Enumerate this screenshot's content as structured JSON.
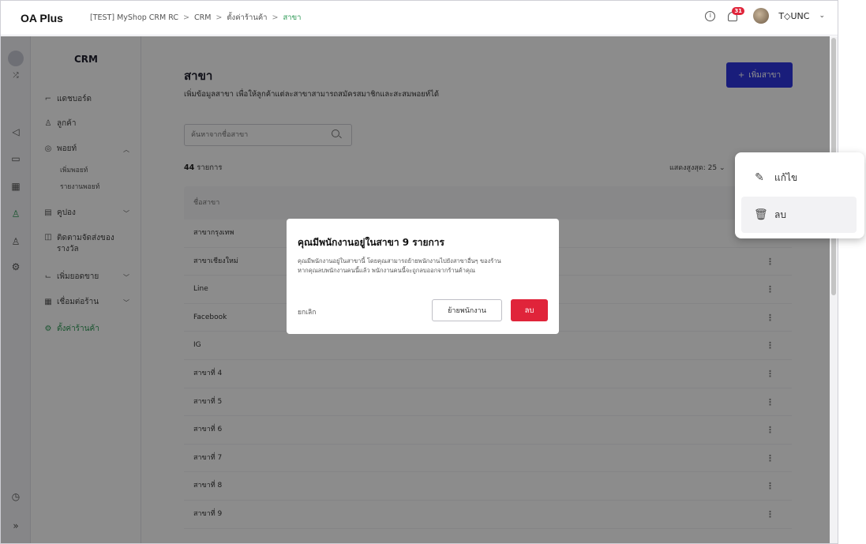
{
  "topbar": {
    "logo": "OA Plus",
    "breadcrumb": [
      "[TEST] MyShop CRM RC",
      "CRM",
      "ตั้งค่าร้านค้า",
      "สาขา"
    ],
    "notification_count": "31",
    "user_name": "T◇UNC"
  },
  "sidebar": {
    "title": "CRM",
    "items": [
      {
        "label": "แดชบอร์ด",
        "icon": "chart-icon"
      },
      {
        "label": "ลูกค้า",
        "icon": "users-icon"
      },
      {
        "label": "พอยท์",
        "icon": "point-icon"
      },
      {
        "label": "เพิ่มพอยท์"
      },
      {
        "label": "รายงานพอยท์"
      },
      {
        "label": "คูปอง",
        "icon": "coupon-icon"
      },
      {
        "label": "ติดตามจัดส่งของรางวัล",
        "icon": "gift-icon"
      },
      {
        "label": "เพิ่มยอดขาย",
        "icon": "sales-icon"
      },
      {
        "label": "เชื่อมต่อร้าน",
        "icon": "store-icon"
      },
      {
        "label": "ตั้งค่าร้านค้า",
        "icon": "settings-icon"
      }
    ]
  },
  "main": {
    "title": "สาขา",
    "description": "เพิ่มข้อมูลสาขา เพื่อให้ลูกค้าแต่ละสาขาสามารถสมัครสมาชิกและสะสมพอยท์ได้",
    "add_button": "เพิ่มสาขา",
    "search_placeholder": "ค้นหาจากชื่อสาขา",
    "count_number": "44",
    "count_suffix": "รายการ",
    "per_page_label": "แสดงสูงสุด:",
    "per_page_value": "25",
    "table_header": "ชื่อสาขา",
    "rows": [
      "สาขากรุงเทพ",
      "สาขาเชียงใหม่",
      "Line",
      "Facebook",
      "IG",
      "สาขาที่ 4",
      "สาขาที่ 5",
      "สาขาที่ 6",
      "สาขาที่ 7",
      "สาขาที่ 8",
      "สาขาที่ 9"
    ]
  },
  "modal": {
    "title": "คุณมีพนักงานอยู่ในสาขา 9 รายการ",
    "body_line1": "คุณมีพนักงานอยู่ในสาขานี้ โดยคุณสามารถย้ายพนักงานไปยังสาขาอื่นๆ ของร้าน",
    "body_line2": "หากคุณลบพนักงานคนนี้แล้ว พนักงานคนนี้จะถูกลบออกจากร้านค้าคุณ",
    "cancel": "ยกเลิก",
    "move": "ย้ายพนักงาน",
    "delete": "ลบ"
  },
  "popover": {
    "edit": "แก้ไข",
    "delete": "ลบ"
  },
  "colors": {
    "primary": "#2f35e0",
    "danger": "#e0243a",
    "active_green": "#2f9a57"
  }
}
